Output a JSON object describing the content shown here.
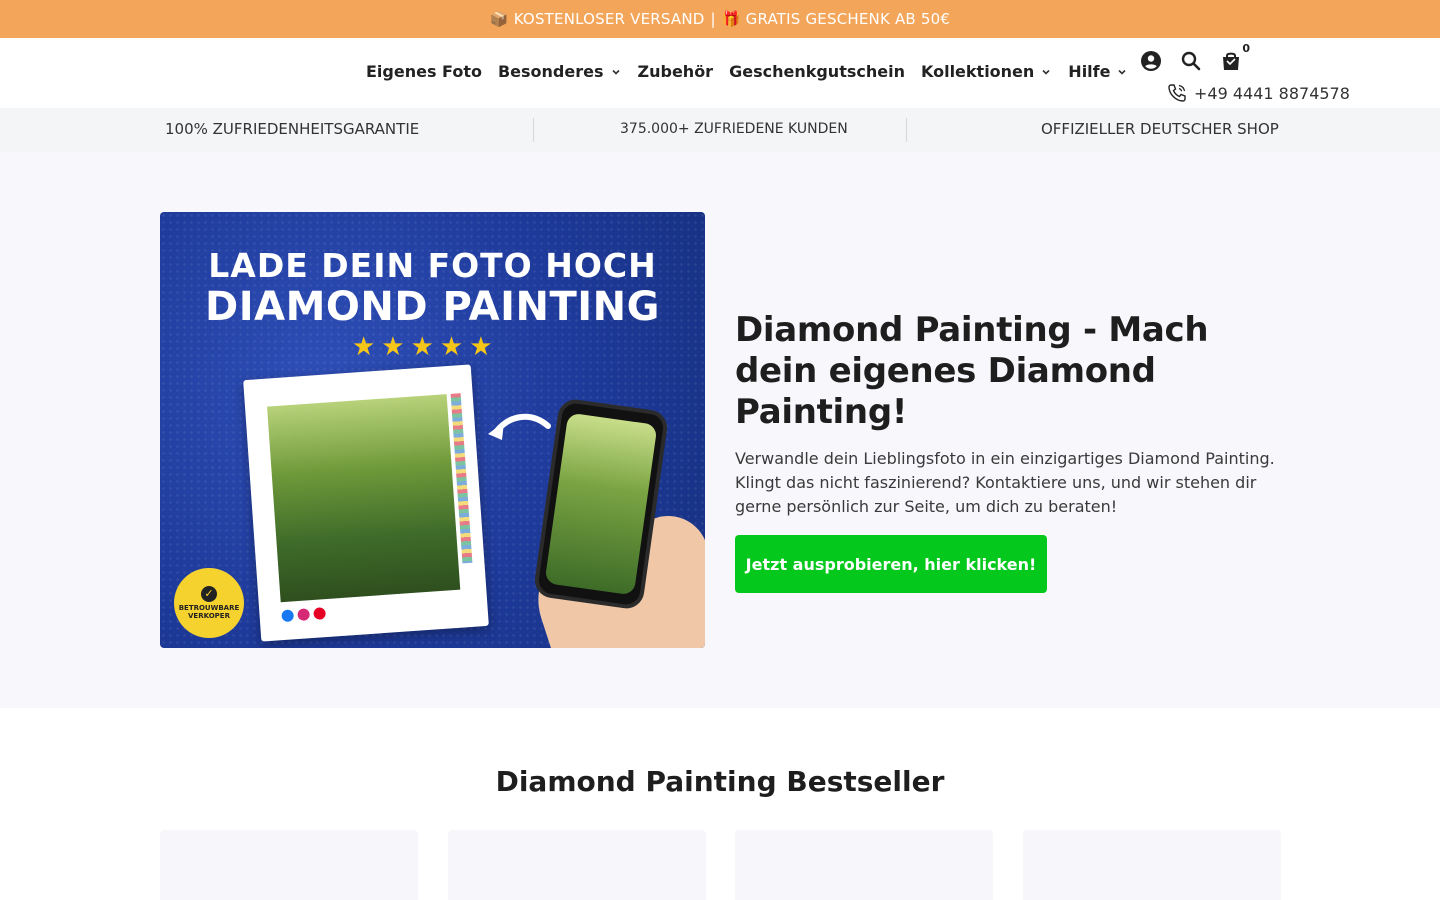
{
  "announcement": {
    "icon1": "package-emoji",
    "text1": "📦 KOSTENLOSER VERSAND",
    "sep": "|",
    "text2": "🎁 GRATIS GESCHENK AB 50€"
  },
  "nav": {
    "items": [
      {
        "label": "Eigenes Foto",
        "dropdown": false
      },
      {
        "label": "Besonderes",
        "dropdown": true
      },
      {
        "label": "Zubehör",
        "dropdown": false
      },
      {
        "label": "Geschenkgutschein",
        "dropdown": false
      },
      {
        "label": "Kollektionen",
        "dropdown": true
      },
      {
        "label": "Hilfe",
        "dropdown": true
      }
    ]
  },
  "header": {
    "icons": [
      "account-icon",
      "search-icon",
      "cart-icon"
    ],
    "cart_count": "0",
    "phone": "+49 4441 8874578"
  },
  "usp": {
    "items": [
      "100% ZUFRIEDENHEITSGARANTIE",
      "375.000+ ZUFRIEDENE KUNDEN",
      "OFFIZIELLER DEUTSCHER SHOP"
    ]
  },
  "hero": {
    "image": {
      "line1": "LADE DEIN FOTO HOCH",
      "line2": "DIAMOND PAINTING",
      "stars": "★★★★★",
      "badge_line1": "BETROUWBARE",
      "badge_line2": "VERKOPER"
    },
    "title": "Diamond Painting - Mach dein eigenes Diamond Painting!",
    "description": "Verwandle dein Lieblingsfoto in ein einzigartiges Diamond Painting. Klingt das nicht faszinierend? Kontaktiere uns, und wir stehen dir gerne persönlich zur Seite, um dich zu beraten!",
    "cta": "Jetzt ausprobieren, hier klicken!"
  },
  "bestseller": {
    "title": "Diamond Painting Bestseller"
  },
  "colors": {
    "announcement_bg": "#f3a55a",
    "cta_bg": "#04c91c",
    "hero_bg": "#f7f7fc",
    "usp_bg": "#f4f5f7"
  }
}
